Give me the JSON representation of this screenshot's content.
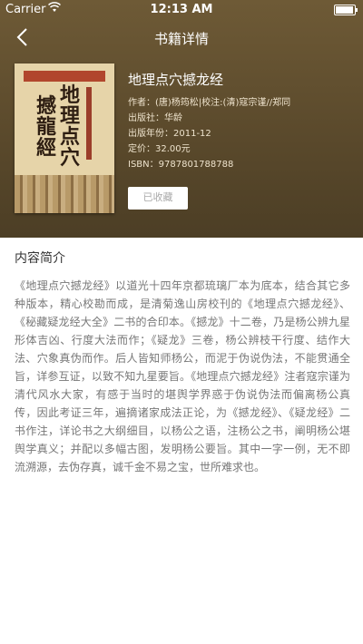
{
  "status_bar": {
    "carrier": "Carrier",
    "time": "12:13 AM"
  },
  "nav": {
    "title": "书籍详情"
  },
  "book": {
    "title": "地理点穴撼龙经",
    "author_line": "作者：(唐)杨筠松|校注:(清)寇宗谨//郑同",
    "publisher_line": "出版社：华龄",
    "year_line": "出版年份：2011-12",
    "price_line": "定价：32.00元",
    "isbn_line": "ISBN：9787801788788",
    "cover": {
      "title_glyphs": [
        "地",
        "理",
        "点",
        "穴",
        "撼",
        "龍",
        "經"
      ]
    }
  },
  "favorite_button": {
    "label": "已收藏"
  },
  "intro": {
    "heading": "内容简介",
    "text": "《地理点穴撼龙经》以道光十四年京都琉璃厂本为底本，结合其它多种版本，精心校勘而成，是清菊逸山房校刊的《地理点穴撼龙经》、《秘藏疑龙经大全》二书的合印本。《撼龙》十二卷，乃是杨公辨九星形体吉凶、行度大法而作；《疑龙》三卷，杨公辨枝干行度、结作大法、穴象真伪而作。后人皆知师杨公，而泥于伪说伪法，不能贯通全旨，详参互证，以致不知九星要旨。《地理点穴撼龙经》注者寇宗谨为清代风水大家，有感于当时的堪舆学界惑于伪说伪法而偏离杨公真传，因此考证三年，遍摘诸家成法正论，为《撼龙经》、《疑龙经》二书作注，详论书之大纲细目，以杨公之语，注杨公之书，阐明杨公堪舆学真义；并配以多幅古图，发明杨公要旨。其中一字一例，无不即流溯源，去伪存真，诚千金不易之宝，世所难求也。"
  },
  "colors": {
    "header_bg": "#5b4a2c",
    "accent_text": "#ffffff",
    "body_text": "#777777"
  }
}
